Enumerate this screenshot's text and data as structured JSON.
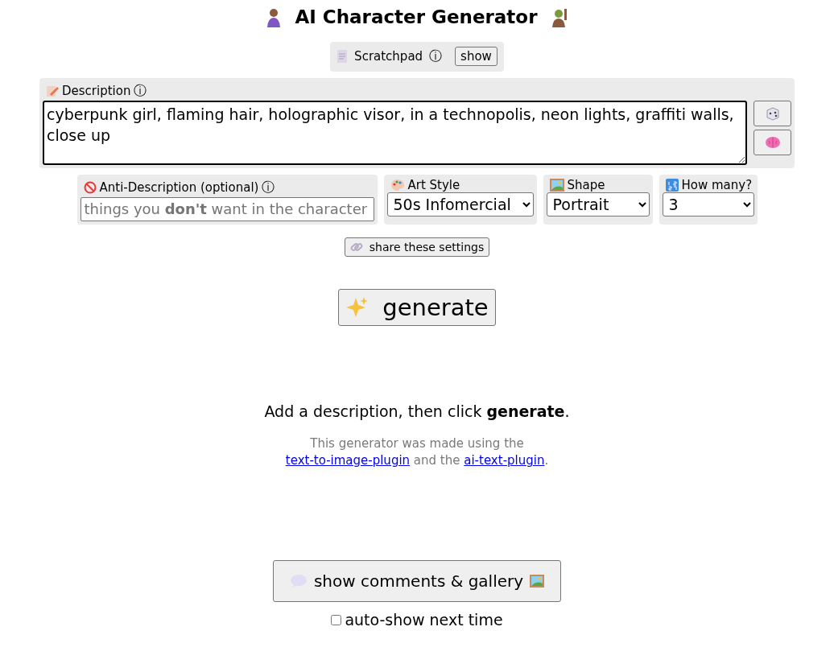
{
  "title": "AI Character Generator",
  "scratchpad": {
    "label": "Scratchpad",
    "info": "ⓘ",
    "button": "show"
  },
  "description": {
    "label": "Description",
    "info": "ⓘ",
    "value": "cyberpunk girl, flaming hair, holographic visor, in a technopolis, neon lights, graffiti walls, close up"
  },
  "anti_description": {
    "label": "Anti-Description (optional)",
    "info": "ⓘ",
    "placeholder": "things you **don't** want in the character"
  },
  "art_style": {
    "label": "Art Style",
    "value": "50s Infomercial"
  },
  "shape": {
    "label": "Shape",
    "value": "Portrait"
  },
  "how_many": {
    "label": "How many?",
    "value": "3"
  },
  "share_button": "share these settings",
  "generate_button": "generate",
  "hint": "Add a description, then click **generate**.",
  "credits": {
    "text": "This generator was made using the",
    "link_1": "text-to-image-plugin",
    "joiner": "and the",
    "link_2": "ai-text-plugin",
    "end": "."
  },
  "comments_button": "show comments & gallery",
  "auto_show": {
    "label": "auto-show next time",
    "checked": false
  }
}
